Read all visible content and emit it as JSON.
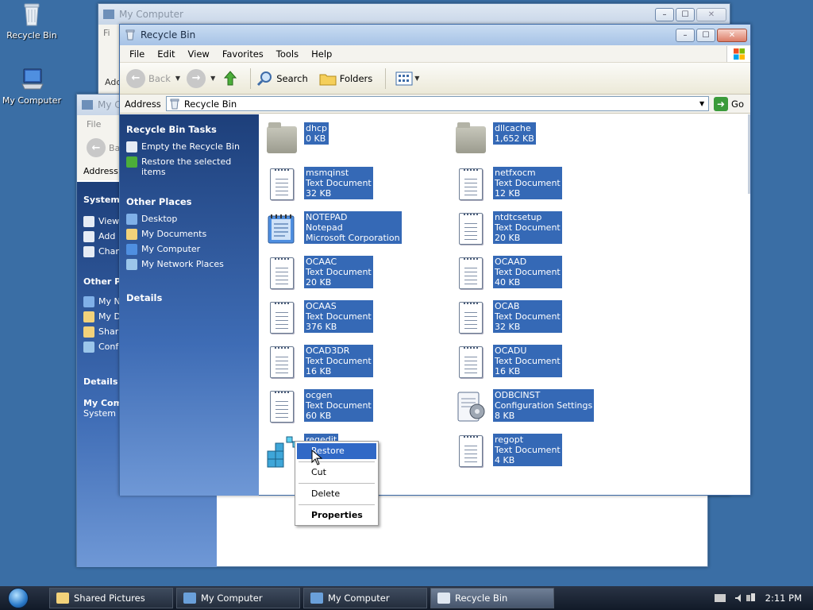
{
  "desktop": {
    "icons": [
      {
        "label": "Recycle Bin"
      },
      {
        "label": "My Computer"
      }
    ]
  },
  "bg_windows": {
    "back": {
      "title": "My Computer",
      "menu_first": "Fi",
      "address_partial": "Add"
    },
    "middle": {
      "title": "My C",
      "menu_first": "File",
      "back_partial": "Ba",
      "address_label": "Address",
      "system_tasks": "System T",
      "items": [
        "View",
        "Add",
        "Chan"
      ],
      "other_places": "Other Pla",
      "places": [
        "My N",
        "My D",
        "Shar",
        "Conf"
      ],
      "details": "Details",
      "details_name": "My Com",
      "details_desc": "System F"
    }
  },
  "window": {
    "title": "Recycle Bin",
    "menu": [
      "File",
      "Edit",
      "View",
      "Favorites",
      "Tools",
      "Help"
    ],
    "toolbar": {
      "back": "Back",
      "search": "Search",
      "folders": "Folders"
    },
    "address": {
      "label": "Address",
      "value": "Recycle Bin",
      "go": "Go"
    },
    "taskpane": {
      "tasks_header": "Recycle Bin Tasks",
      "tasks": [
        "Empty the Recycle Bin",
        "Restore the selected items"
      ],
      "places_header": "Other Places",
      "places": [
        "Desktop",
        "My Documents",
        "My Computer",
        "My Network Places"
      ],
      "details_header": "Details"
    },
    "files": [
      {
        "name": "dhcp",
        "line2": "0 KB",
        "line3": "",
        "icon": "folder-icon"
      },
      {
        "name": "dllcache",
        "line2": "1,652 KB",
        "line3": "",
        "icon": "folder-icon"
      },
      {
        "name": "msmqinst",
        "line2": "Text Document",
        "line3": "32 KB",
        "icon": "text-document-icon"
      },
      {
        "name": "netfxocm",
        "line2": "Text Document",
        "line3": "12 KB",
        "icon": "text-document-icon"
      },
      {
        "name": "NOTEPAD",
        "line2": "Notepad",
        "line3": "Microsoft Corporation",
        "icon": "notepad-icon"
      },
      {
        "name": "ntdtcsetup",
        "line2": "Text Document",
        "line3": "20 KB",
        "icon": "text-document-icon"
      },
      {
        "name": "OCAAC",
        "line2": "Text Document",
        "line3": "20 KB",
        "icon": "text-document-icon"
      },
      {
        "name": "OCAAD",
        "line2": "Text Document",
        "line3": "40 KB",
        "icon": "text-document-icon"
      },
      {
        "name": "OCAAS",
        "line2": "Text Document",
        "line3": "376 KB",
        "icon": "text-document-icon"
      },
      {
        "name": "OCAB",
        "line2": "Text Document",
        "line3": "32 KB",
        "icon": "text-document-icon"
      },
      {
        "name": "OCAD3DR",
        "line2": "Text Document",
        "line3": "16 KB",
        "icon": "text-document-icon"
      },
      {
        "name": "OCADU",
        "line2": "Text Document",
        "line3": "16 KB",
        "icon": "text-document-icon"
      },
      {
        "name": "ocgen",
        "line2": "Text Document",
        "line3": "60 KB",
        "icon": "text-document-icon"
      },
      {
        "name": "ODBCINST",
        "line2": "Configuration Settings",
        "line3": "8 KB",
        "icon": "config-settings-icon"
      },
      {
        "name": "regedit",
        "line2": "",
        "line3": "ation",
        "icon": "regedit-icon"
      },
      {
        "name": "regopt",
        "line2": "Text Document",
        "line3": "4 KB",
        "icon": "text-document-icon"
      }
    ]
  },
  "context_menu": {
    "items": [
      "Restore",
      "Cut",
      "Delete",
      "Properties"
    ]
  },
  "taskbar": {
    "tasks": [
      "Shared Pictures",
      "My Computer",
      "My Computer",
      "Recycle Bin"
    ],
    "clock": "2:11 PM"
  },
  "colors": {
    "desktop": "#3a6ea5",
    "selection": "#3569b6",
    "taskpane_top": "#1d3f7a"
  }
}
